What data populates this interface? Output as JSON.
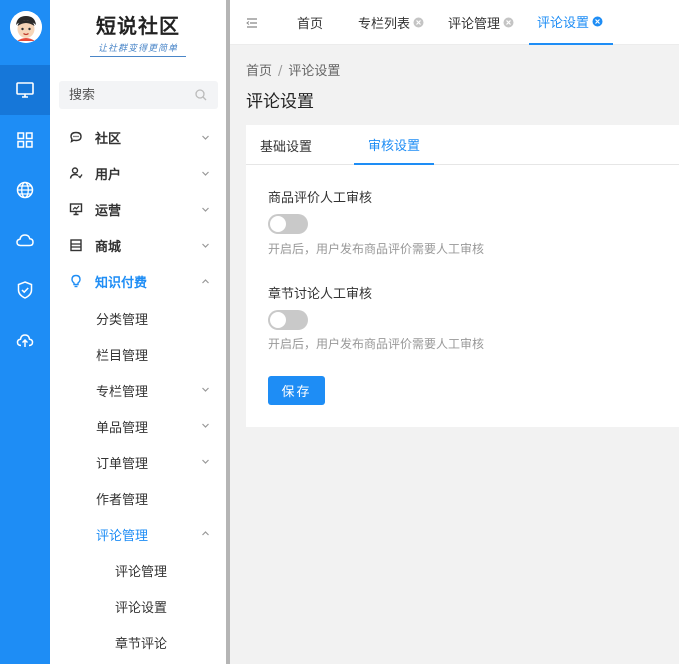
{
  "logo": {
    "title": "短说社区",
    "subtitle": "让社群变得更简单"
  },
  "rail": [
    {
      "icon": "monitor-icon",
      "active": true
    },
    {
      "icon": "grid-icon"
    },
    {
      "icon": "globe-icon"
    },
    {
      "icon": "cloud-icon"
    },
    {
      "icon": "shield-check-icon"
    },
    {
      "icon": "cloud-upload-icon"
    }
  ],
  "search": {
    "placeholder": "搜索"
  },
  "menu": {
    "community": "社区",
    "users": "用户",
    "operations": "运营",
    "mall": "商城",
    "paid": "知识付费",
    "paid_children": {
      "category": "分类管理",
      "column": "栏目管理",
      "special": "专栏管理",
      "single": "单品管理",
      "orders": "订单管理",
      "authors": "作者管理",
      "comments": "评论管理",
      "comment_children": {
        "manage": "评论管理",
        "settings": "评论设置",
        "chapter": "章节评论"
      }
    }
  },
  "tabs": {
    "home": "首页",
    "special_list": "专栏列表",
    "comment_manage": "评论管理",
    "comment_settings": "评论设置"
  },
  "breadcrumb": {
    "home": "首页",
    "sep": "/",
    "current": "评论设置"
  },
  "page_title": "评论设置",
  "content_tabs": {
    "basic": "基础设置",
    "review": "审核设置"
  },
  "form": {
    "product_review_label": "商品评价人工审核",
    "product_review_hint": "开启后，用户发布商品评价需要人工审核",
    "product_review_on": false,
    "chapter_review_label": "章节讨论人工审核",
    "chapter_review_hint": "开启后，用户发布商品评价需要人工审核",
    "chapter_review_on": false,
    "save": "保存"
  },
  "colors": {
    "accent": "#1e8df5",
    "rail": "#1e8df5"
  }
}
